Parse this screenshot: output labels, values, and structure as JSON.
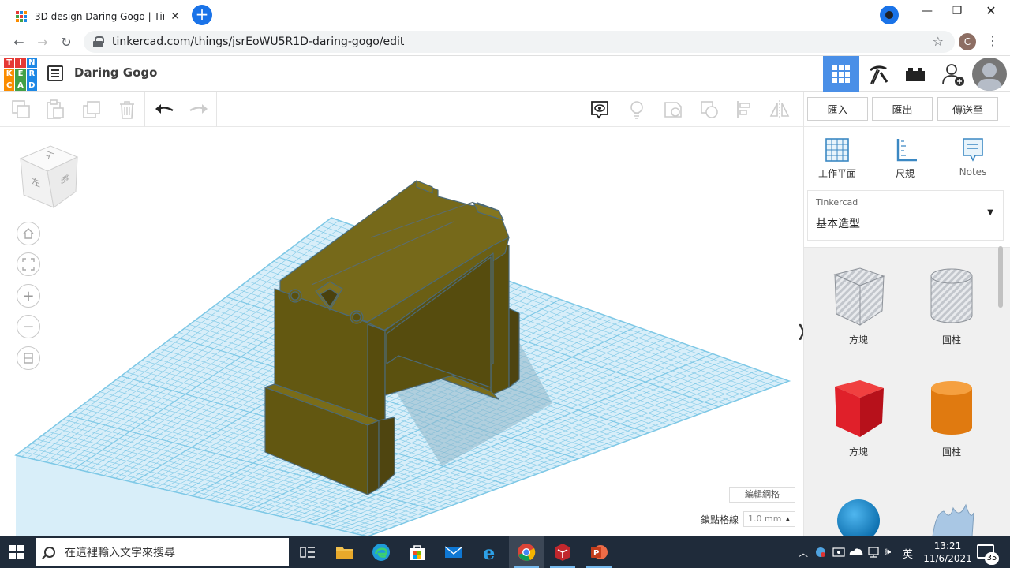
{
  "browser": {
    "tab_title": "3D design Daring Gogo | Tinkercad",
    "url": "tinkercad.com/things/jsrEoWU5R1D-daring-gogo/edit",
    "profile_initial": "C"
  },
  "app": {
    "logo_letters": [
      "T",
      "I",
      "N",
      "K",
      "E",
      "R",
      "C",
      "A",
      "D"
    ],
    "logo_colors": [
      "#e53935",
      "#e53935",
      "#1e88e5",
      "#fb8c00",
      "#43a047",
      "#1e88e5",
      "#fb8c00",
      "#43a047",
      "#1e88e5"
    ],
    "design_title": "Daring Gogo",
    "accent": "#4a8fe7"
  },
  "toolbar": {
    "import_label": "匯入",
    "export_label": "匯出",
    "send_label": "傳送至"
  },
  "panel": {
    "tools": [
      {
        "label": "工作平面",
        "icon": "workplane-icon"
      },
      {
        "label": "尺規",
        "icon": "ruler-icon"
      },
      {
        "label": "Notes",
        "icon": "notes-icon"
      }
    ],
    "library_source": "Tinkercad",
    "library_category": "基本造型",
    "shapes": [
      {
        "label": "方塊",
        "icon": "box-hole-icon",
        "color": "#b0b4bb"
      },
      {
        "label": "圓柱",
        "icon": "cylinder-hole-icon",
        "color": "#b0b4bb"
      },
      {
        "label": "方塊",
        "icon": "box-icon",
        "color": "#e0202a"
      },
      {
        "label": "圓柱",
        "icon": "cylinder-icon",
        "color": "#f08a1c"
      },
      {
        "label": "",
        "icon": "sphere-icon",
        "color": "#1d8fd6"
      },
      {
        "label": "",
        "icon": "scribble-icon",
        "color": "#a9c7e4"
      }
    ]
  },
  "viewport": {
    "cube_face_top": "上",
    "cube_face_left": "左",
    "cube_face_front": "前",
    "edit_grid_label": "編輯網格",
    "snap_label": "鎖點格線",
    "snap_value": "1.0 mm",
    "grid_color": "#7ec8e6",
    "model_color": "#6b5e12"
  },
  "taskbar": {
    "search_placeholder": "在這裡輸入文字來搜尋",
    "ime_label": "英",
    "time": "13:21",
    "date": "11/6/2021",
    "notification_count": "35"
  }
}
